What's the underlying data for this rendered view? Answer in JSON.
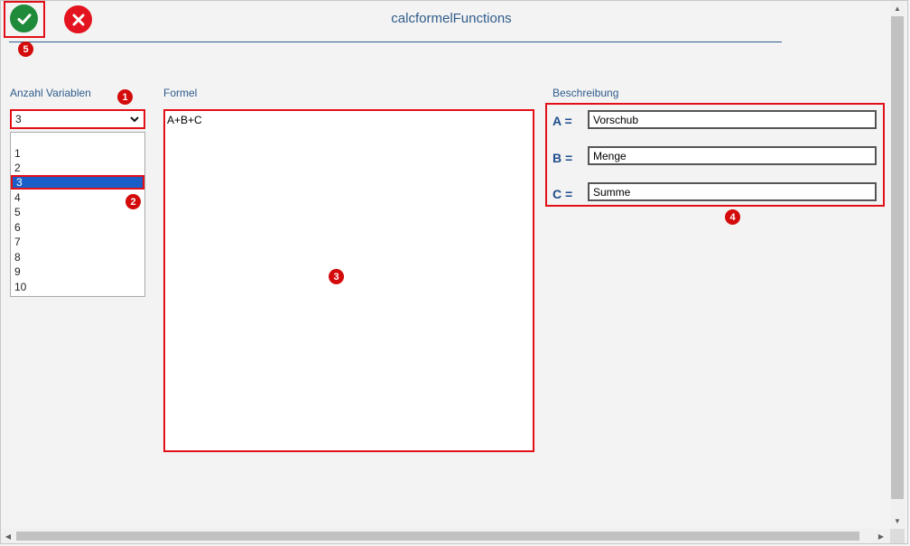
{
  "window": {
    "title": "calcformelFunctions"
  },
  "toolbar": {
    "ok_icon": "check-circle-icon",
    "cancel_icon": "x-circle-icon",
    "ok_color": "#1e8a3a",
    "cancel_color": "#e3141f"
  },
  "badges": [
    "1",
    "2",
    "3",
    "4",
    "5"
  ],
  "variables": {
    "label": "Anzahl Variablen",
    "selected": "3",
    "options": [
      "1",
      "2",
      "3",
      "4",
      "5",
      "6",
      "7",
      "8",
      "9",
      "10"
    ]
  },
  "formula": {
    "label": "Formel",
    "value": "A+B+C"
  },
  "description": {
    "label": "Beschreibung",
    "rows": [
      {
        "var": "A =",
        "value": "Vorschub"
      },
      {
        "var": "B =",
        "value": "Menge"
      },
      {
        "var": "C =",
        "value": "Summe"
      }
    ]
  },
  "colors": {
    "accent": "#2f5c8c",
    "highlight": "#e30f17",
    "selection": "#1a5fc8"
  }
}
